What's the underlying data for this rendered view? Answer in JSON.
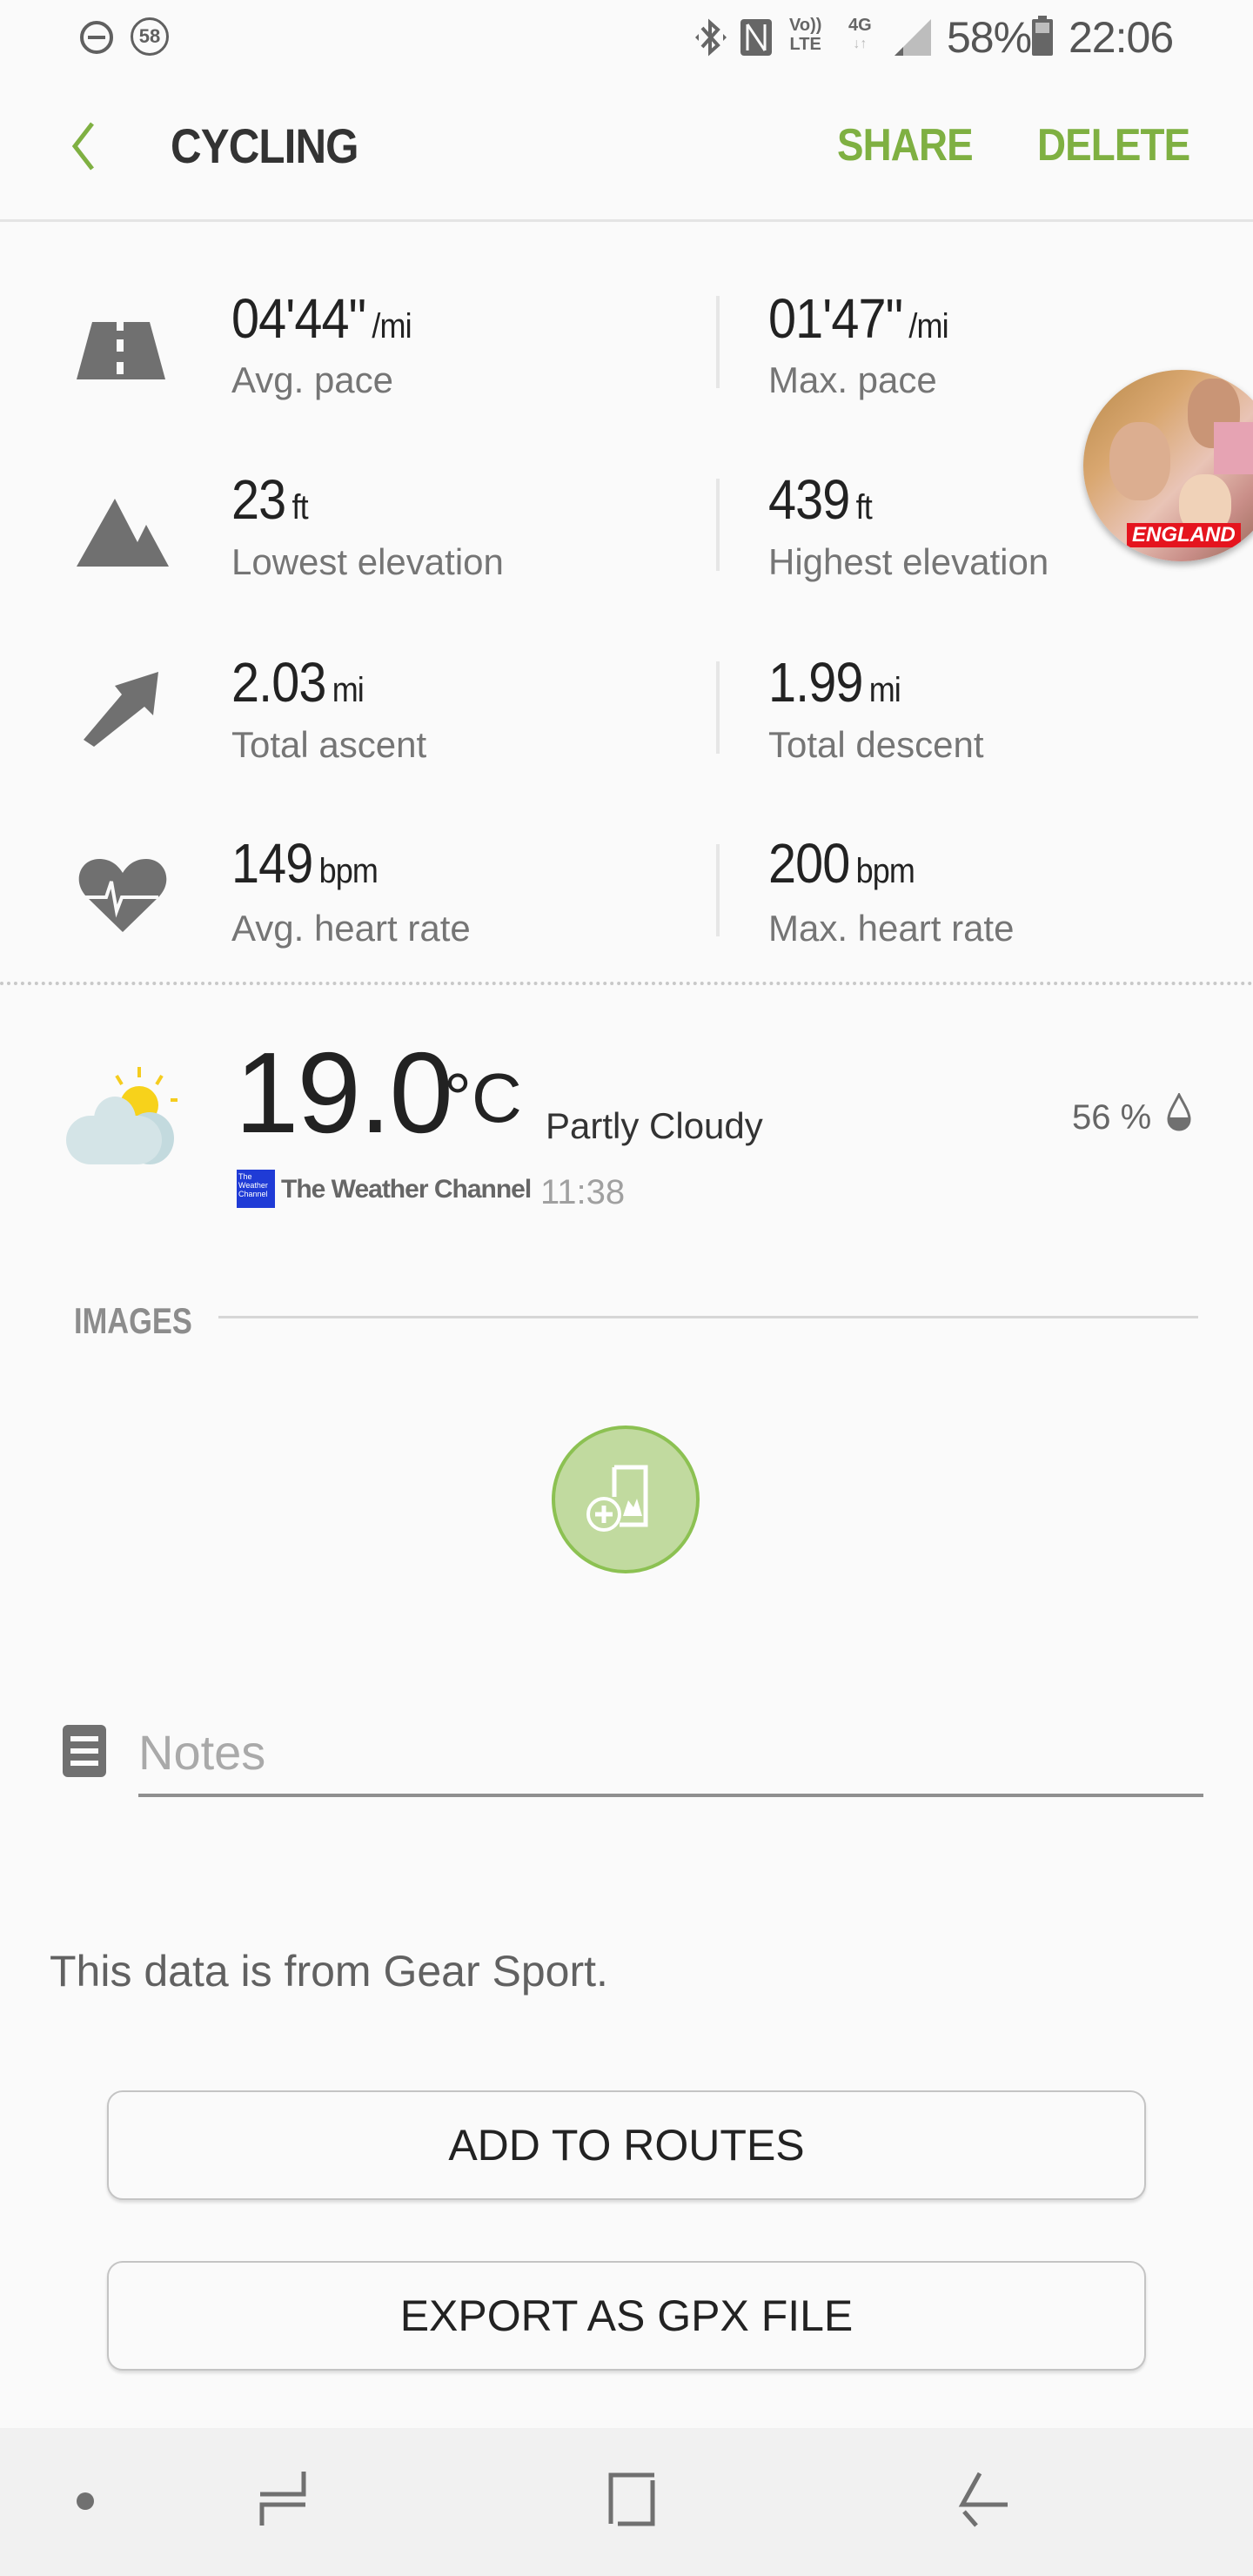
{
  "status_bar": {
    "left_icons": [
      "do-not-disturb-icon",
      "notification-count-icon"
    ],
    "notification_count": "58",
    "right_icons": [
      "bluetooth-icon",
      "nfc-icon",
      "volte-icon",
      "4g-data-icon",
      "signal-icon",
      "battery-icon"
    ],
    "volte_top": "Vo))",
    "volte_bottom": "LTE",
    "network": "4G",
    "battery": "58%",
    "time": "22:06"
  },
  "header": {
    "title": "CYCLING",
    "share_label": "SHARE",
    "delete_label": "DELETE",
    "accent_color": "#7fb042"
  },
  "stats": [
    {
      "icon": "road-icon",
      "left": {
        "value": "04'44\"",
        "unit": "/mi",
        "label": "Avg. pace"
      },
      "right": {
        "value": "01'47\"",
        "unit": "/mi",
        "label": "Max. pace"
      }
    },
    {
      "icon": "mountain-icon",
      "left": {
        "value": "23",
        "unit": "ft",
        "label": "Lowest elevation"
      },
      "right": {
        "value": "439",
        "unit": "ft",
        "label": "Highest elevation"
      }
    },
    {
      "icon": "ascent-arrow-icon",
      "left": {
        "value": "2.03",
        "unit": "mi",
        "label": "Total ascent"
      },
      "right": {
        "value": "1.99",
        "unit": "mi",
        "label": "Total descent"
      }
    },
    {
      "icon": "heart-rate-icon",
      "left": {
        "value": "149",
        "unit": "bpm",
        "label": "Avg. heart rate"
      },
      "right": {
        "value": "200",
        "unit": "bpm",
        "label": "Max. heart rate"
      }
    }
  ],
  "avatar": {
    "caption": "ENGLAND"
  },
  "weather": {
    "icon": "partly-cloudy-icon",
    "temperature": "19.0",
    "unit": "°C",
    "condition": "Partly Cloudy",
    "provider": "The Weather Channel",
    "provider_logo_lines": [
      "The",
      "Weather",
      "Channel"
    ],
    "time": "11:38",
    "humidity": "56 %",
    "humidity_icon": "humidity-drop-icon"
  },
  "images_section": {
    "label": "IMAGES",
    "add_button_icon": "add-image-icon"
  },
  "notes": {
    "placeholder": "Notes",
    "value": ""
  },
  "source_text": "This data is from Gear Sport.",
  "buttons": {
    "add_to_routes": "ADD TO ROUTES",
    "export_gpx": "EXPORT AS GPX FILE"
  },
  "nav_bar": {
    "items": [
      "nav-dot",
      "recent-apps-icon",
      "home-icon",
      "back-icon"
    ]
  }
}
